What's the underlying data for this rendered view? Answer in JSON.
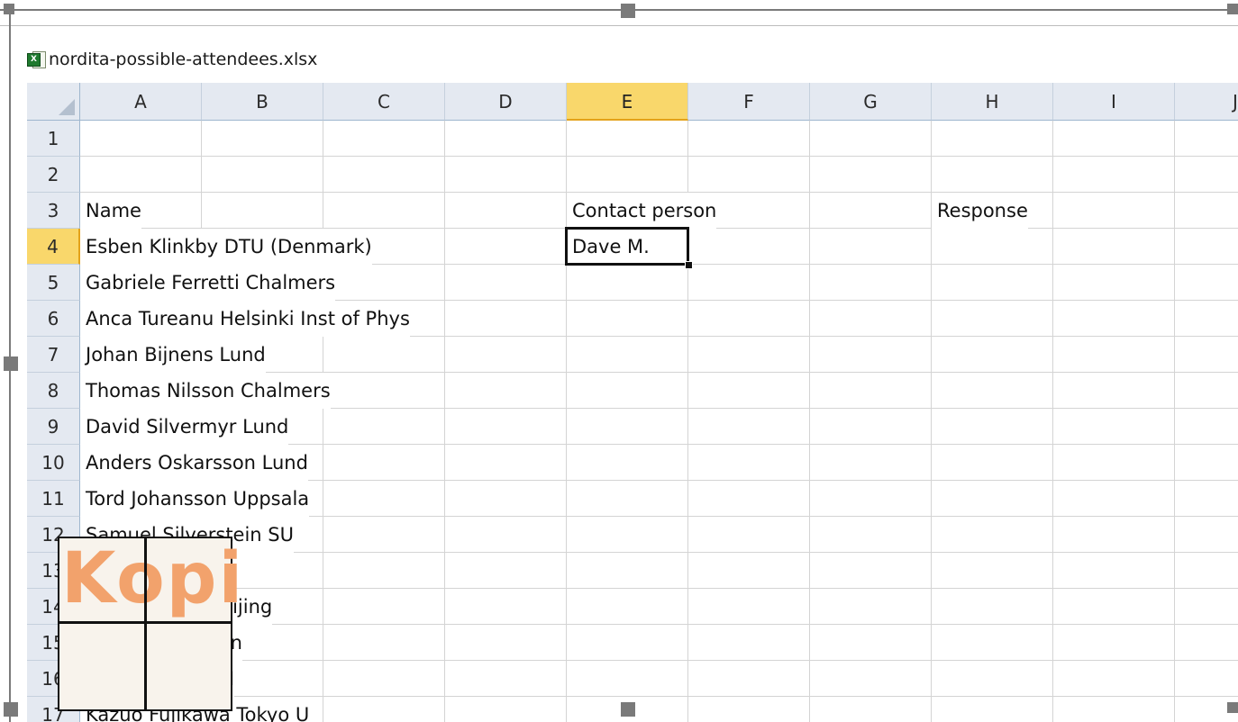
{
  "window": {
    "file_name": "nordita-possible-attendees.xlsx"
  },
  "columns": [
    "A",
    "B",
    "C",
    "D",
    "E",
    "F",
    "G",
    "H",
    "I",
    "J"
  ],
  "selected_column": "E",
  "rows": [
    {
      "num": "1",
      "a": "",
      "e": "",
      "h": ""
    },
    {
      "num": "2",
      "a": "",
      "e": "",
      "h": ""
    },
    {
      "num": "3",
      "a": "Name",
      "e": "Contact person",
      "h": "Response"
    },
    {
      "num": "4",
      "a": "Esben Klinkby DTU (Denmark)",
      "e": "Dave M.",
      "h": ""
    },
    {
      "num": "5",
      "a": "Gabriele Ferretti Chalmers",
      "e": "",
      "h": ""
    },
    {
      "num": "6",
      "a": "Anca Tureanu Helsinki Inst of Phys",
      "e": "",
      "h": ""
    },
    {
      "num": "7",
      "a": "Johan Bijnens Lund",
      "e": "",
      "h": ""
    },
    {
      "num": "8",
      "a": "Thomas Nilsson Chalmers",
      "e": "",
      "h": ""
    },
    {
      "num": "9",
      "a": "David Silvermyr Lund",
      "e": "",
      "h": ""
    },
    {
      "num": "10",
      "a": "Anders Oskarsson Lund",
      "e": "",
      "h": ""
    },
    {
      "num": "11",
      "a": "Tord Johansson Uppsala",
      "e": "",
      "h": ""
    },
    {
      "num": "12",
      "a": "Samuel Silverstein SU",
      "e": "",
      "h": ""
    },
    {
      "num": "13",
      "a": "nov Tel Aviv",
      "e": "",
      "h": ""
    },
    {
      "num": "14",
      "a": "bi Bruxelles, Beijing",
      "e": "",
      "h": ""
    },
    {
      "num": "15",
      "a": "chard IPNL, Lyon",
      "e": "",
      "h": ""
    },
    {
      "num": "16",
      "a": "y Munchen, MPI",
      "e": "",
      "h": ""
    },
    {
      "num": "17",
      "a": "Kazuo Fujikawa Tokyo U",
      "e": "",
      "h": ""
    }
  ],
  "active_cell": "E4",
  "overlay": {
    "text": "Kopi"
  },
  "colors": {
    "header_bg": "#e4e9f1",
    "selected_header": "#f9d76b",
    "overlay_text": "#f2a26c"
  }
}
